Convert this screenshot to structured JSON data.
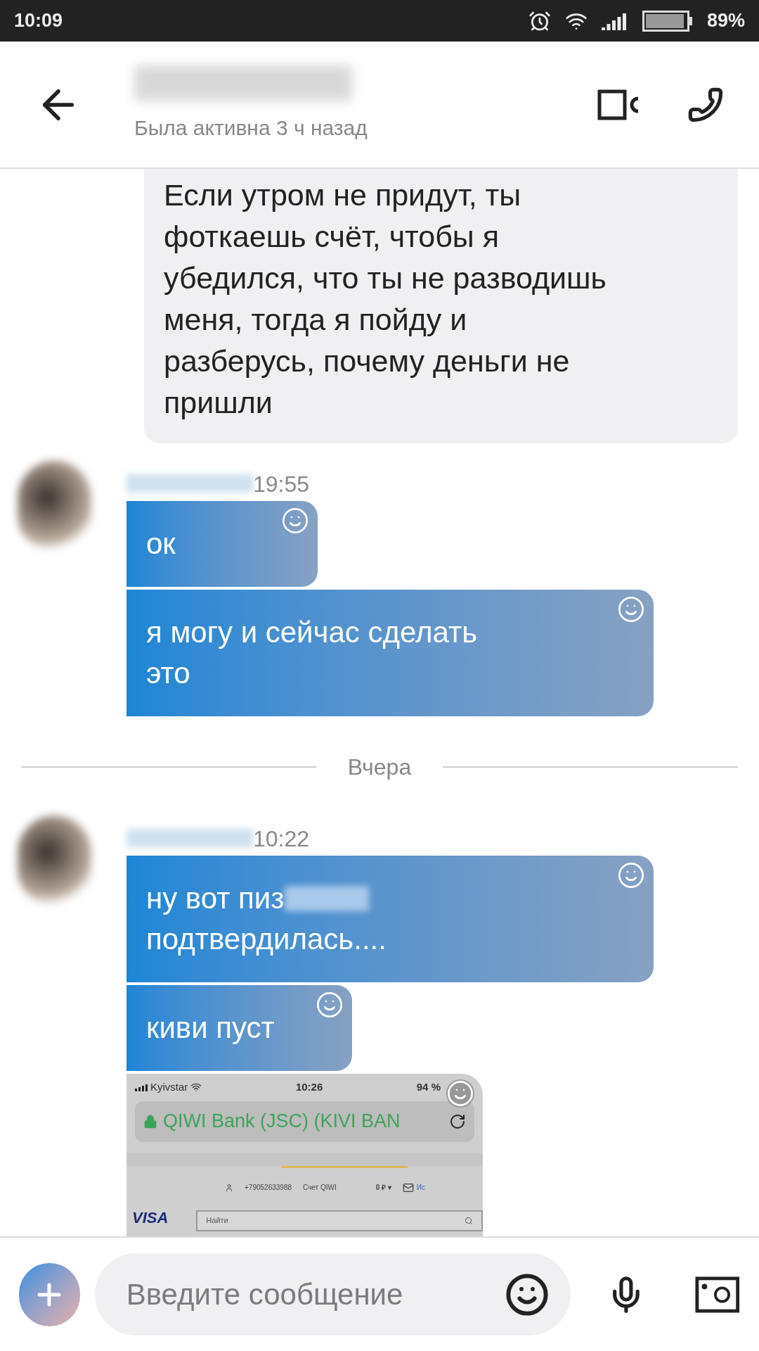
{
  "status_bar": {
    "time": "10:09",
    "battery": "89%"
  },
  "header": {
    "status": "Была активна 3 ч назад"
  },
  "messages": [
    {
      "kind": "outgoing",
      "lines": [
        "Если утром не придут, ты",
        "фоткаешь счёт, чтобы я",
        "убедился, что ты не разводишь",
        "меня, тогда я пойду и",
        "разберусь, почему деньги не",
        "пришли"
      ]
    },
    {
      "kind": "incoming_group",
      "time": "19:55",
      "bubbles": [
        {
          "lines": [
            "ок"
          ],
          "blurred": false
        },
        {
          "lines": [
            "я могу и сейчас сделать",
            "это"
          ],
          "blurred": false
        }
      ]
    },
    {
      "kind": "date",
      "text": "Вчера"
    },
    {
      "kind": "incoming_group",
      "time": "10:22",
      "bubbles": [
        {
          "lines": [
            "ну вот пиз",
            "подтвердилась...."
          ],
          "blurred": true
        },
        {
          "lines": [
            "киви пуст"
          ],
          "blurred": false
        },
        {
          "kind": "screenshot",
          "carrier": "Kyivstar",
          "time": "10:26",
          "battery": "94 %",
          "url": "QIWI Bank (JSC) (KIVI BAN",
          "phone": "+79052633988",
          "account": "Счет QIWI",
          "balance": "0 ₽ ▾",
          "link": "Ис",
          "card": "VISA",
          "search_placeholder": "Найти"
        }
      ]
    }
  ],
  "composer": {
    "placeholder": "Введите сообщение"
  }
}
